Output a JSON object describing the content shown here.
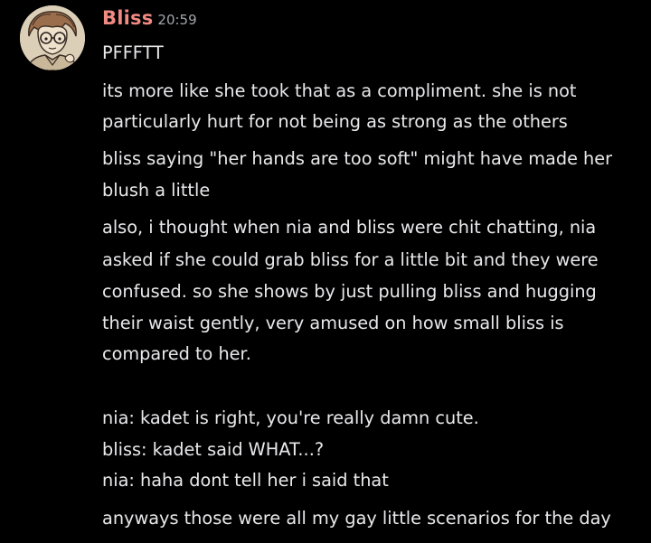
{
  "message": {
    "username": "Bliss",
    "timestamp": "20:59",
    "avatar_icon": "anime-character-avatar",
    "username_color": "#f08a83",
    "lines": [
      "PFFFTT",
      "its more like she took that as a compliment. she is not",
      "particularly hurt for not being as strong as the others",
      "bliss saying \"her hands are too soft\" might have made her",
      "blush a little",
      "also, i thought when nia and bliss were chit chatting, nia",
      "asked if she could grab bliss for a little bit and they were",
      "confused. so she shows by just pulling bliss and hugging",
      "their waist gently, very amused on how small bliss is",
      "compared to her.",
      "nia: kadet is right, you're really damn cute.",
      "bliss: kadet said WHAT...?",
      "nia: haha dont tell her i said that",
      "anyways those were all my gay little scenarios for the day"
    ]
  }
}
